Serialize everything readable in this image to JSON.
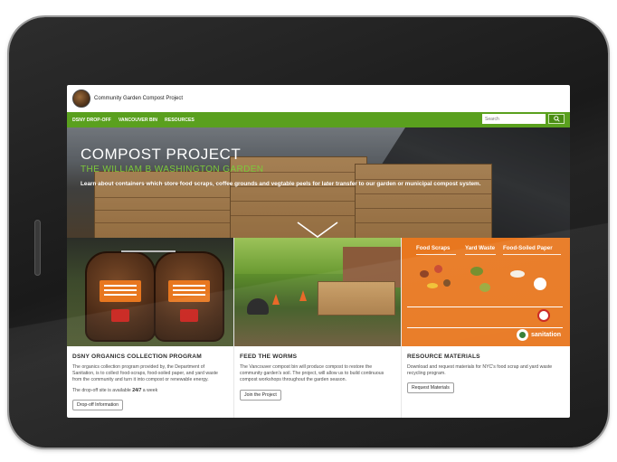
{
  "site": {
    "title": "Community Garden Compost Project"
  },
  "nav": {
    "items": [
      "DSNY DROP-OFF",
      "VANCOUVER BIN",
      "RESOURCES"
    ],
    "search_placeholder": "Search",
    "search_icon": "search-icon"
  },
  "hero": {
    "title": "COMPOST PROJECT",
    "subtitle": "THE WILLIAM B WASHINGTON GARDEN",
    "description": "Learn about containers which store food scraps, coffee grounds and vegtable peels for later transfer to our garden or municipal compost system.",
    "scroll_icon": "chevron-down-icon"
  },
  "cards": [
    {
      "title": "DSNY ORGANICS COLLECTION PROGRAM",
      "text": "The organics collection program provided by, the Department of Sanitation, is to collect food-scraps, food-soiled paper, and yard waste from the community and turn it into compost or renewable energy.",
      "availability_prefix": "The drop-off site is available ",
      "availability_value": "24/7",
      "availability_suffix": " a week",
      "button": "Drop-off Information"
    },
    {
      "title": "FEED THE WORMS",
      "text": "The Vancouver compost bin will produce compost to restore the community garden's soil. The project, will allow us to build continuous compost workshops throughout the garden season.",
      "button": "Join the Project"
    },
    {
      "title": "RESOURCE MATERIALS",
      "text": "Download and request materials for NYC's food scrap and yard waste recycling program.",
      "button": "Request Materials"
    }
  ],
  "poster": {
    "headings": [
      "Food Scraps",
      "Yard Waste",
      "Food-Soiled Paper"
    ],
    "logo": "sanitation"
  },
  "colors": {
    "nav_green": "#5aa01e",
    "subtitle_green": "#7cc93a",
    "poster_orange": "#e8771f"
  }
}
